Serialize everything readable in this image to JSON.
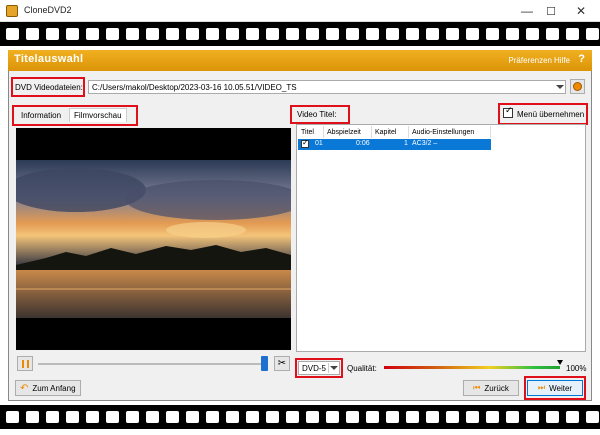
{
  "window": {
    "title": "CloneDVD2",
    "minimize": "—",
    "maximize": "☐",
    "close": "✕"
  },
  "header": {
    "title": "Titelauswahl",
    "preferences": "Präferenzen",
    "help": "Hilfe",
    "help_icon": "?"
  },
  "source": {
    "label": "DVD Videodateien:",
    "path": "C:/Users/makol/Desktop/2023-03-16 10.05.51/VIDEO_TS"
  },
  "tabs": [
    {
      "label": "Information"
    },
    {
      "label": "Filmvorschau"
    }
  ],
  "video_title_label": "Video Titel:",
  "menu_checkbox": {
    "label": "Menü übernehmen",
    "checked": true
  },
  "table": {
    "columns": [
      "Titel",
      "Abspielzeit",
      "Kapitel",
      "Audio-Einstellungen"
    ],
    "rows": [
      {
        "checked": true,
        "titel": "01",
        "abspielzeit": "0:06",
        "kapitel": "1",
        "audio": "AC3/2 –"
      }
    ]
  },
  "dvd_format": {
    "selected": "DVD-5"
  },
  "quality": {
    "label": "Qualität:",
    "value_text": "100%",
    "value": 1.0
  },
  "buttons": {
    "start": "Zum Anfang",
    "back": "Zurück",
    "next": "Weiter"
  },
  "colors": {
    "accent": "#E8A010",
    "highlight": "#E0101A",
    "selection": "#0A78D7"
  }
}
